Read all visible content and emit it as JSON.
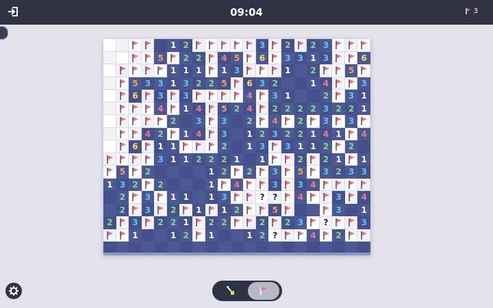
{
  "header": {
    "timer": "09:04",
    "flags_remaining": "3",
    "exit_icon": "exit-icon",
    "flag_icon": "flag-icon"
  },
  "board": {
    "cols": 21,
    "rows": 17,
    "colors": {
      "1": "#ffffff",
      "2": "#86d98a",
      "3": "#5cc6f0",
      "4": "#f07a8a",
      "5": "#f5a15c",
      "6": "#f5e25c",
      "flag": "#f06a7a"
    },
    "grid": [
      "..FF.12FFFFF3F2F23FFFF",
      "..FF5F22F45F6F3313FF66F",
      ".FFFF111F13FFF1.2FF5FF",
      ".F53313225F632..14FF32",
      ".F6F3F3FFFF4F31..2F31.",
      ".FFF4F14F524F22223221",
      ".FFFF2.3F3.2F4F2F3F3F",
      ".FF42F14F3.12322141F41",
      ".F6F11FFF2.13F3112F2.",
      "FFFF3112221.1FF2F21F1.",
      "F5F2....12F2F3F5F3233F21",
      "132F2...1F4FF3F34FFFF2F",
      ".2F3F11.13FF??F4FF3F423F2",
      ".2F3F2F1F12FF5F..F3.1F",
      "2F3F221F22FF2F23F?FF3F2F33",
      "FF1..12F1..12?FF4F2FF",
      "......................."
    ]
  },
  "toolbar": {
    "reveal_icon": "shovel-icon",
    "flag_mode_icon": "flag-icon",
    "active": "flag"
  },
  "settings_icon": "gear-icon"
}
